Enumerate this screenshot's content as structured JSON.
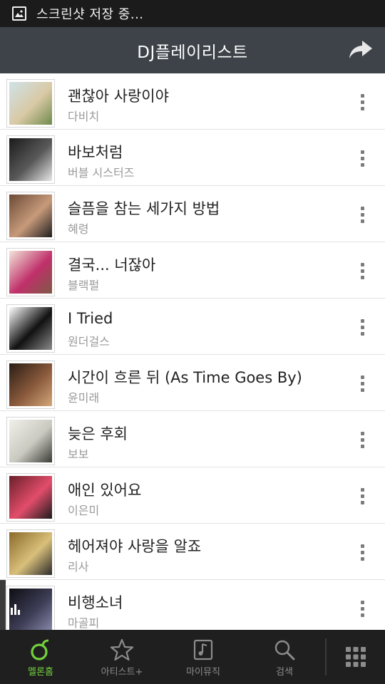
{
  "statusbar": {
    "text": "스크린샷 저장 중..."
  },
  "header": {
    "title": "DJ플레이리스트"
  },
  "songs": [
    {
      "title": "괜찮아 사랑이야",
      "artist": "다비치",
      "colors": [
        "#cfe2e8",
        "#d9c9a5",
        "#6f8a4c"
      ]
    },
    {
      "title": "바보처럼",
      "artist": "버블 시스터즈",
      "colors": [
        "#1a1a1a",
        "#5a5a5a",
        "#e7e7e7"
      ]
    },
    {
      "title": "슬픔을 참는 세가지 방법",
      "artist": "혜령",
      "colors": [
        "#6b4a36",
        "#c79a7a",
        "#1e1e1e"
      ]
    },
    {
      "title": "결국... 너잖아",
      "artist": "블랙펄",
      "colors": [
        "#f2e6da",
        "#c0306a",
        "#7e5a45"
      ]
    },
    {
      "title": "I Tried",
      "artist": "원더걸스",
      "colors": [
        "#ffffff",
        "#111111",
        "#8a8a8a"
      ]
    },
    {
      "title": "시간이 흐른 뒤 (As Time Goes By)",
      "artist": "윤미래",
      "colors": [
        "#2a1c14",
        "#8a5a3c",
        "#d4a77a"
      ]
    },
    {
      "title": "늦은 후회",
      "artist": "보보",
      "colors": [
        "#f0f0ea",
        "#c9c9c0",
        "#3a3a36"
      ]
    },
    {
      "title": "애인 있어요",
      "artist": "이은미",
      "colors": [
        "#6a1f2a",
        "#e24d6b",
        "#1b1b1b"
      ]
    },
    {
      "title": "헤어져야 사랑을 알죠",
      "artist": "리사",
      "colors": [
        "#8a6a2a",
        "#d8bf7a",
        "#2a2a2a"
      ]
    },
    {
      "title": "비행소녀",
      "artist": "마골피",
      "colors": [
        "#0e0e14",
        "#3c3c55",
        "#8888aa"
      ]
    }
  ],
  "tabs": [
    {
      "label": "멜론홈",
      "icon": "melon-home-icon"
    },
    {
      "label": "아티스트+",
      "icon": "star-icon"
    },
    {
      "label": "마이뮤직",
      "icon": "music-note-icon"
    },
    {
      "label": "검색",
      "icon": "search-icon"
    }
  ],
  "colors": {
    "accent": "#73d13d",
    "header_bg": "#3d4349",
    "tabbar_bg": "#1f1f1f",
    "statusbar_bg": "#1b1b1b"
  }
}
